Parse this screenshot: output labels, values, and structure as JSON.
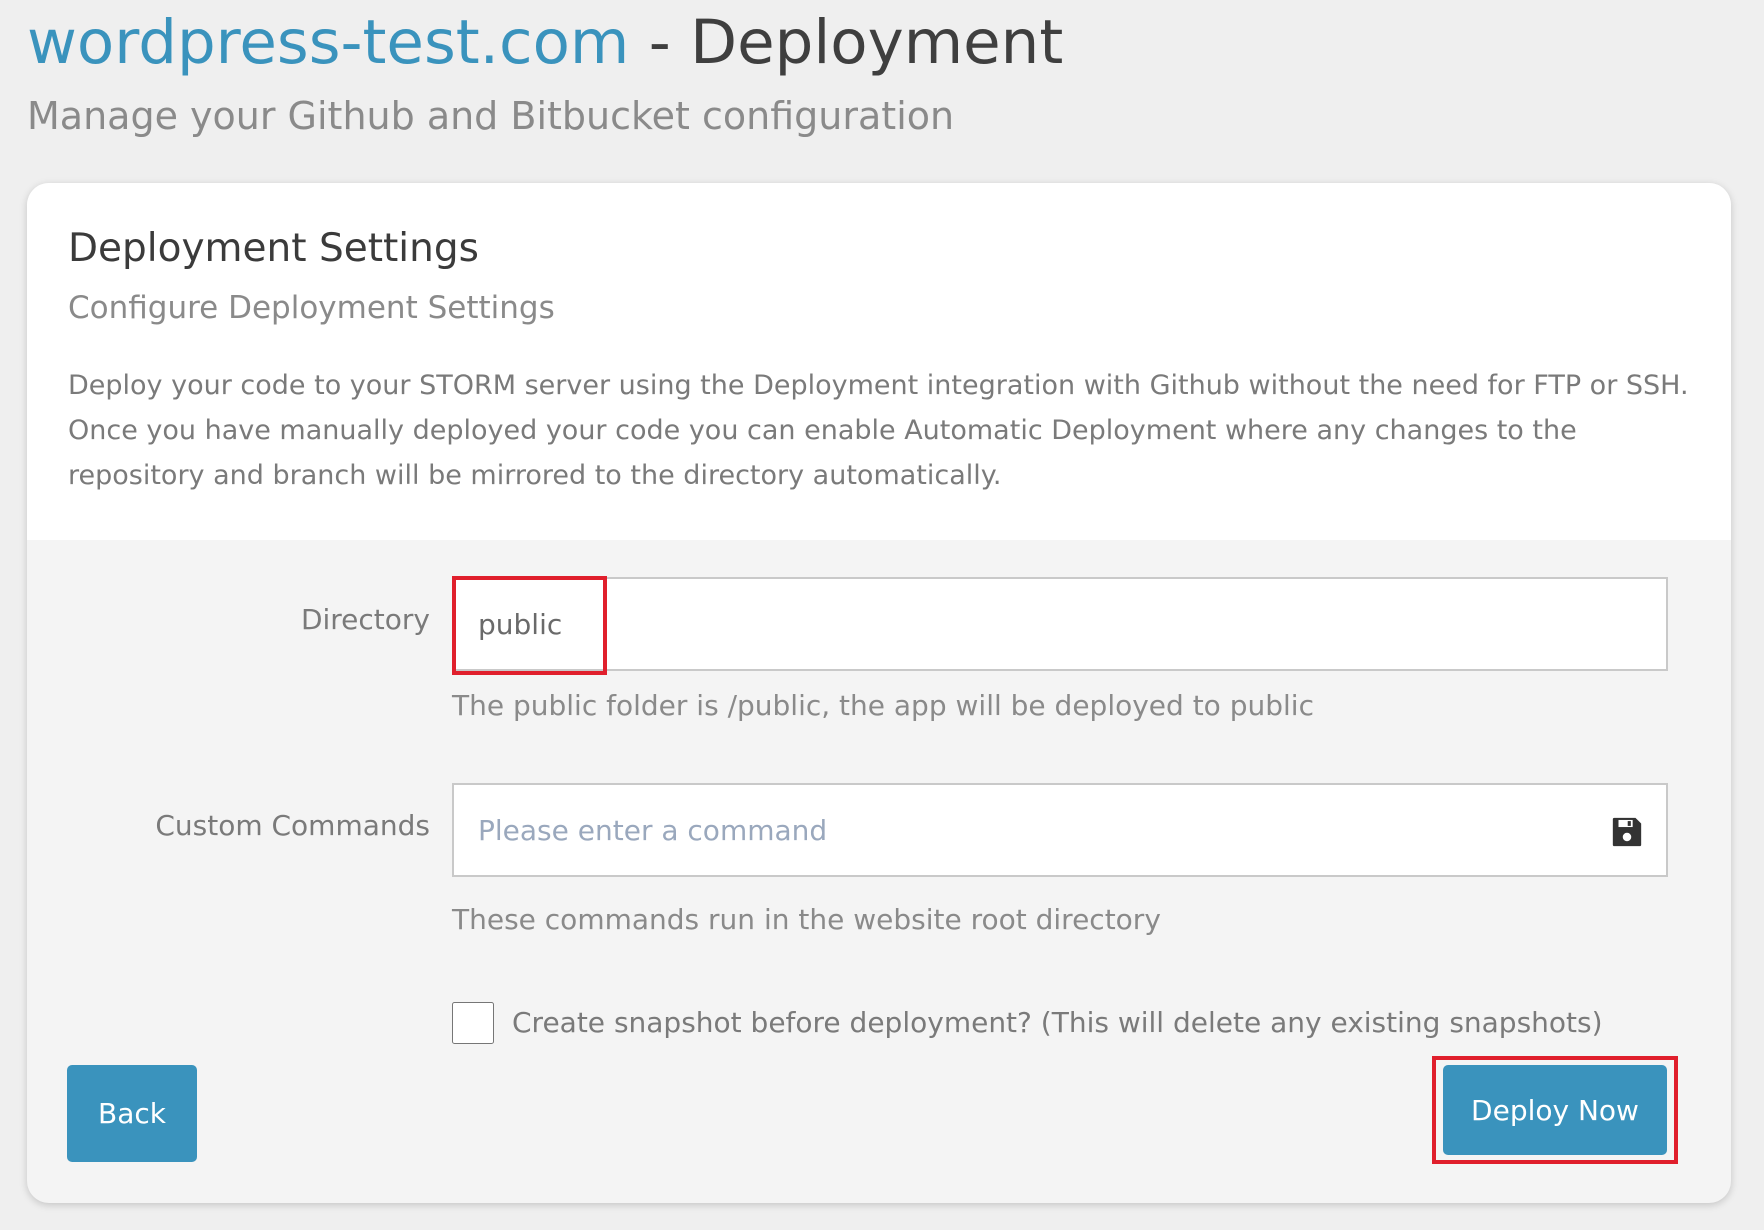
{
  "header": {
    "site_name": "wordpress-test.com",
    "title_suffix": " - Deployment",
    "subtitle": "Manage your Github and Bitbucket configuration"
  },
  "card": {
    "title": "Deployment Settings",
    "subtitle": "Configure Deployment Settings",
    "description": "Deploy your code to your STORM server using the Deployment integration with Github without the need for FTP or SSH. Once you have manually deployed your code you can enable Automatic Deployment where any changes to the repository and branch will be mirrored to the directory automatically."
  },
  "form": {
    "directory": {
      "label": "Directory",
      "value": "public",
      "help": "The public folder is /public, the app will be deployed to public"
    },
    "custom_commands": {
      "label": "Custom Commands",
      "value": "",
      "placeholder": "Please enter a command",
      "help": "These commands run in the website root directory",
      "icon": "save-icon"
    },
    "snapshot": {
      "label": "Create snapshot before deployment? (This will delete any existing snapshots)",
      "checked": false
    }
  },
  "buttons": {
    "back": "Back",
    "deploy": "Deploy Now"
  },
  "colors": {
    "accent": "#3a93bd",
    "highlight": "#e01f2c",
    "background": "#efefef"
  }
}
